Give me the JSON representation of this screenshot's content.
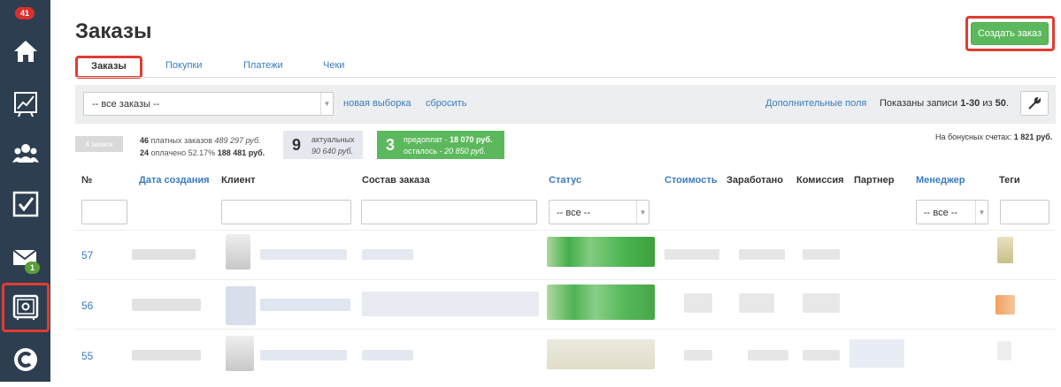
{
  "sidebar": {
    "top_badge": "41",
    "mail_badge": "1",
    "items": [
      {
        "icon": "home-icon"
      },
      {
        "icon": "chart-icon"
      },
      {
        "icon": "users-icon"
      },
      {
        "icon": "checkbox-icon"
      },
      {
        "icon": "mail-icon"
      },
      {
        "icon": "safe-icon"
      },
      {
        "icon": "logo-c-icon"
      }
    ]
  },
  "header": {
    "title": "Заказы",
    "create_button": "Создать заказ"
  },
  "tabs": [
    "Заказы",
    "Покупки",
    "Платежи",
    "Чеки"
  ],
  "filter": {
    "select_value": "-- все заказы --",
    "new_selection": "новая выборка",
    "reset": "сбросить",
    "extra_fields": "Дополнительные поля",
    "shown_prefix": "Показаны записи ",
    "shown_range": "1-30",
    "shown_mid": " из ",
    "shown_total": "50",
    "shown_suffix": "."
  },
  "stats": {
    "tag_count": "4 заявок",
    "paid_count": "46",
    "paid_label": "платных заказов",
    "paid_sum": "489 297 руб.",
    "paid_done_count": "24",
    "paid_done_label": "оплачено 52.17%",
    "paid_done_sum": "188 481 руб.",
    "actual_count": "9",
    "actual_label": "актуальных",
    "actual_sum": "90 640 руб.",
    "prepay_count": "3",
    "prepay_label": "предоплат - ",
    "prepay_sum": "18 070 руб.",
    "left_label": "осталось - ",
    "left_sum": "20 850 руб.",
    "bonus_label": "На бонусных счетах: ",
    "bonus_sum": "1 821 руб."
  },
  "table": {
    "columns": [
      "№",
      "Дата создания",
      "Клиент",
      "Состав заказа",
      "Статус",
      "Стоимость",
      "Заработано",
      "Комиссия",
      "Партнер",
      "Менеджер",
      "Теги"
    ],
    "status_filter": "-- все --",
    "manager_filter": "-- все --",
    "rows": [
      {
        "no": "57"
      },
      {
        "no": "56"
      },
      {
        "no": "55"
      }
    ]
  },
  "colors": {
    "sidebar_bg": "#2d3e50",
    "accent_green": "#5cb85c",
    "link_blue": "#3a7bbf",
    "highlight_red": "#e03c31",
    "badge_red": "#d9302c"
  }
}
